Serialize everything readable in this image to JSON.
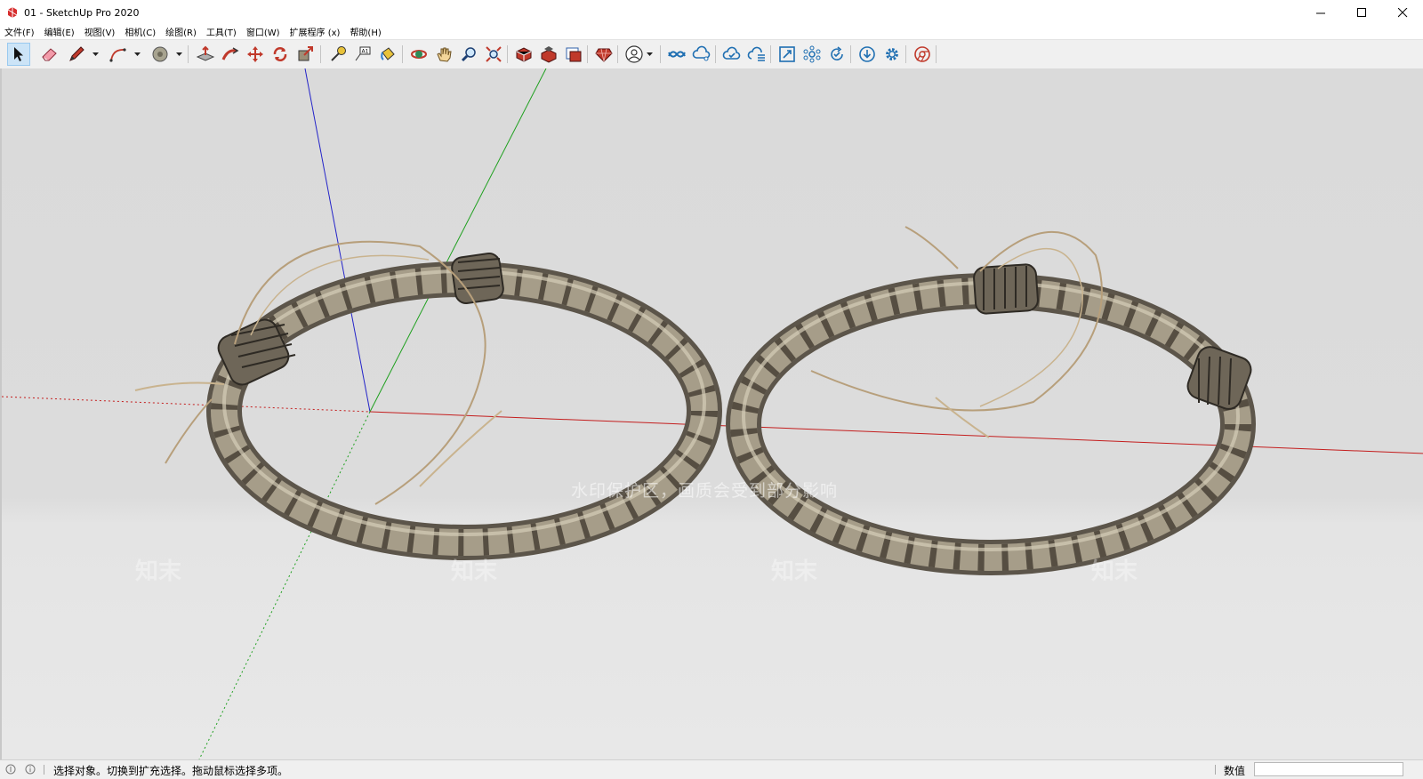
{
  "window": {
    "title": "01 - SketchUp Pro 2020",
    "controls": [
      "minimize-icon",
      "maximize-icon",
      "close-icon"
    ]
  },
  "menu": [
    "文件(F)",
    "编辑(E)",
    "视图(V)",
    "相机(C)",
    "绘图(R)",
    "工具(T)",
    "窗口(W)",
    "扩展程序 (x)",
    "帮助(H)"
  ],
  "toolbar": {
    "tools": [
      "select",
      "eraser",
      "line",
      "arc",
      "paint-bucket",
      "push-pull",
      "follow-me",
      "move",
      "rotate",
      "scale",
      "tape-measure",
      "text",
      "paint",
      "orbit",
      "pan",
      "zoom",
      "zoom-extents",
      "3d-warehouse",
      "extension-warehouse",
      "layout",
      "ruby",
      "account",
      "trimble-connect",
      "collaborate",
      "cloud-upload",
      "cloud-list",
      "window-resize",
      "components",
      "sync",
      "download",
      "settings",
      "chrome"
    ],
    "active_tool": "select"
  },
  "viewport": {
    "watermark": "水印保护区，画质会受到部分影响",
    "watermark_marks": [
      "知末",
      "知末",
      "知末",
      "知末"
    ],
    "axis_colors": {
      "red": "#c41e1e",
      "green": "#1fa01f",
      "blue": "#2323c8"
    },
    "objects": [
      "bangle-left",
      "bangle-right"
    ]
  },
  "status": {
    "message": "选择对象。切换到扩充选择。拖动鼠标选择多项。",
    "measurement_label": "数值",
    "measurement_value": ""
  }
}
